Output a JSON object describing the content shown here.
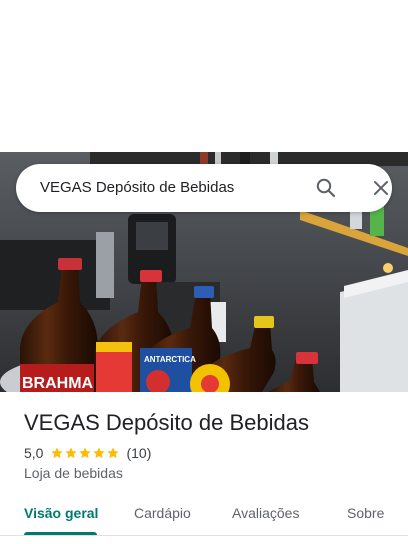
{
  "search": {
    "query": "VEGAS Depósito de Bebidas",
    "search_icon": "search-icon",
    "close_icon": "close-icon"
  },
  "place": {
    "title": "VEGAS Depósito de Bebidas",
    "rating": "5,0",
    "stars": 5,
    "review_count": "(10)",
    "category": "Loja de bebidas"
  },
  "tabs": [
    {
      "label": "Visão geral",
      "active": true
    },
    {
      "label": "Cardápio",
      "active": false
    },
    {
      "label": "Avaliações",
      "active": false
    },
    {
      "label": "Sobre",
      "active": false
    }
  ],
  "colors": {
    "accent": "#01796f",
    "star": "#fbbc04"
  },
  "photo": {
    "bottle_labels": [
      "BRAHMA",
      "ANTARCTICA"
    ]
  }
}
